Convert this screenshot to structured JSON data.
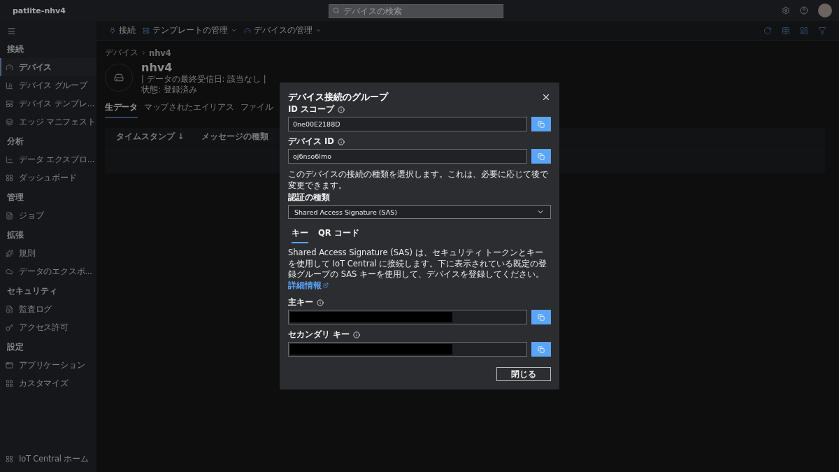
{
  "app_title": "patlite-nhv4",
  "search": {
    "placeholder": "デバイスの検索"
  },
  "sidebar": {
    "sections": [
      {
        "heading": "接続",
        "items": [
          {
            "label": "デバイス",
            "selected": true
          },
          {
            "label": "デバイス グループ",
            "selected": false
          },
          {
            "label": "デバイス テンプレ...",
            "selected": false
          },
          {
            "label": "エッジ マニフェスト",
            "selected": false
          }
        ]
      },
      {
        "heading": "分析",
        "items": [
          {
            "label": "データ エクスプロ...",
            "selected": false
          },
          {
            "label": "ダッシュボード",
            "selected": false
          }
        ]
      },
      {
        "heading": "管理",
        "items": [
          {
            "label": "ジョブ",
            "selected": false
          }
        ]
      },
      {
        "heading": "拡張",
        "items": [
          {
            "label": "規則",
            "selected": false
          },
          {
            "label": "データのエクスポ...",
            "selected": false
          }
        ]
      },
      {
        "heading": "セキュリティ",
        "items": [
          {
            "label": "監査ログ",
            "selected": false
          },
          {
            "label": "アクセス許可",
            "selected": false
          }
        ]
      },
      {
        "heading": "設定",
        "items": [
          {
            "label": "アプリケーション",
            "selected": false
          },
          {
            "label": "カスタマイズ",
            "selected": false
          }
        ]
      }
    ],
    "footer": "IoT Central ホーム"
  },
  "toolbar": [
    {
      "label": "接続",
      "dropdown": false
    },
    {
      "label": "テンプレートの管理",
      "dropdown": true
    },
    {
      "label": "デバイスの管理",
      "dropdown": true
    }
  ],
  "breadcrumb": [
    "デバイス",
    "nhv4"
  ],
  "device": {
    "name": "nhv4",
    "meta": "| データの最終受信日: 該当なし | 状態: 登録済み"
  },
  "tabs": [
    {
      "label": "生データ",
      "selected": true
    },
    {
      "label": "マップされたエイリアス",
      "selected": false
    },
    {
      "label": "ファイル",
      "selected": false
    }
  ],
  "table": {
    "columns": [
      "タイムスタンプ ↓",
      "メッセージの種類"
    ]
  },
  "dialog": {
    "title": "デバイス接続のグループ",
    "fields": [
      {
        "label": "ID スコープ",
        "value": "0ne00E2188D"
      },
      {
        "label": "デバイス ID",
        "value": "oj6nso6lmo"
      }
    ],
    "hint": "このデバイスの接続の種類を選択します。これは、必要に応じて後で変更できます。",
    "auth_label": "認証の種類",
    "auth_value": "Shared Access Signature (SAS)",
    "tabs": [
      {
        "label": "キー",
        "selected": true
      },
      {
        "label": "QR コード",
        "selected": false
      }
    ],
    "description": "Shared Access Signature (SAS) は、セキュリティ トークンとキーを使用して IoT Central に接続します。下に表示されている既定の登録グループの SAS キーを使用して、デバイスを登録してください。",
    "link": "詳細情報",
    "keys": [
      {
        "label": "主キー",
        "masked": true
      },
      {
        "label": "セカンダリ キー",
        "masked": true
      }
    ],
    "close_button": "閉じる"
  }
}
